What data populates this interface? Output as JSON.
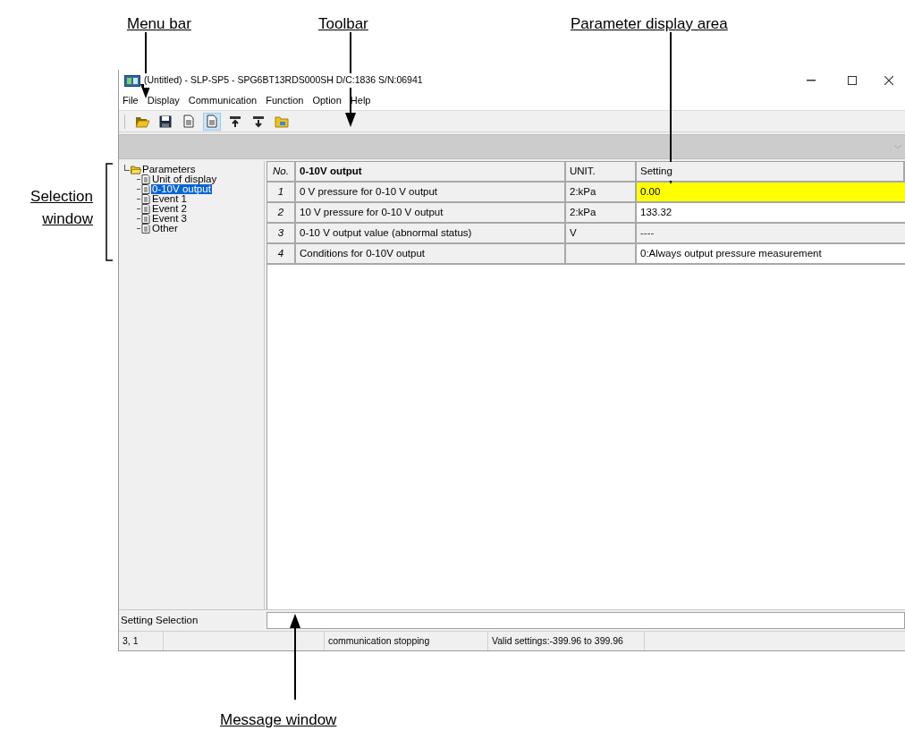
{
  "callouts": [
    {
      "label": "Menu bar"
    },
    {
      "label": "Toolbar"
    },
    {
      "label": "Parameter display area"
    },
    {
      "label": "Selection window"
    },
    {
      "label": "Message window"
    }
  ],
  "window": {
    "title": "(Untitled) - SLP-SP5 - SPG6BT13RDS000SH D/C:1836 S/N:06941",
    "menu": [
      "File",
      "Display",
      "Communication",
      "Function",
      "Option",
      "Help"
    ],
    "toolbar": [
      {
        "kind": "open",
        "pressed": false
      },
      {
        "kind": "save",
        "pressed": false
      },
      {
        "kind": "page",
        "pressed": false
      },
      {
        "kind": "page",
        "pressed": true
      },
      {
        "kind": "upload",
        "pressed": false
      },
      {
        "kind": "download",
        "pressed": false
      },
      {
        "kind": "folder",
        "pressed": false
      }
    ],
    "tree": {
      "label": "Parameters",
      "expanded": true,
      "children": [
        {
          "label": "Unit of display",
          "selected": false
        },
        {
          "label": "0-10V output",
          "selected": true
        },
        {
          "label": "Event 1",
          "selected": false
        },
        {
          "label": "Event 2",
          "selected": false
        },
        {
          "label": "Event 3",
          "selected": false
        },
        {
          "label": "Other",
          "selected": false
        }
      ]
    },
    "table": {
      "columns": [
        "No.",
        "0-10V output",
        "UNIT.",
        "Setting"
      ],
      "rows": [
        {
          "no": "1",
          "name": "0 V pressure for 0-10 V output",
          "unit": "2:kPa",
          "setting": "0.00",
          "editable": true,
          "highlighted": true
        },
        {
          "no": "2",
          "name": "10 V pressure for 0-10 V output",
          "unit": "2:kPa",
          "setting": "133.32",
          "editable": true,
          "highlighted": false
        },
        {
          "no": "3",
          "name": "0-10 V output value (abnormal status)",
          "unit": "V",
          "setting": "----",
          "editable": false,
          "highlighted": false
        },
        {
          "no": "4",
          "name": "Conditions for 0-10V output",
          "unit": "",
          "setting": "0:Always output pressure measurement",
          "editable": true,
          "highlighted": false
        }
      ]
    },
    "message": {
      "label": "Setting Selection"
    },
    "status_bar": [
      "3, 1",
      "communication stopping",
      "Valid settings:-399.96 to 399.96"
    ]
  }
}
